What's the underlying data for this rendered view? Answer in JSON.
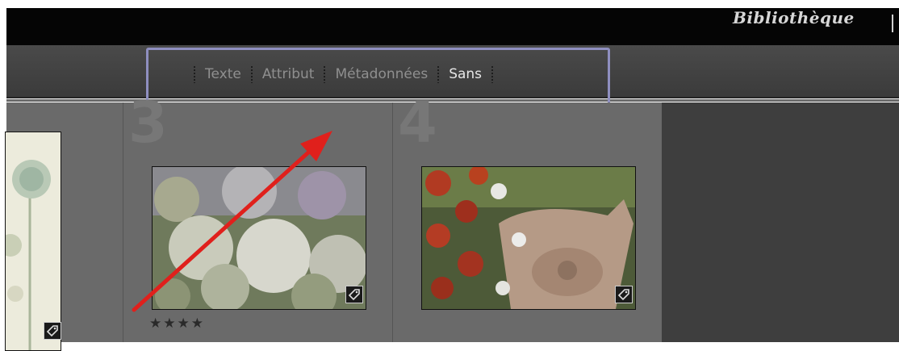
{
  "app": {
    "module": "Bibliothèque"
  },
  "filter_bar": {
    "items": [
      {
        "label": "Texte",
        "active": false
      },
      {
        "label": "Attribut",
        "active": false
      },
      {
        "label": "Métadonnées",
        "active": false
      },
      {
        "label": "Sans",
        "active": true
      }
    ]
  },
  "grid": {
    "cells": [
      {
        "index_label": "3",
        "rating": "★★★★"
      },
      {
        "index_label": "4",
        "rating": ""
      }
    ]
  },
  "annotation": {
    "color": "#e0201c",
    "highlight_color": "#8f8fc0"
  }
}
